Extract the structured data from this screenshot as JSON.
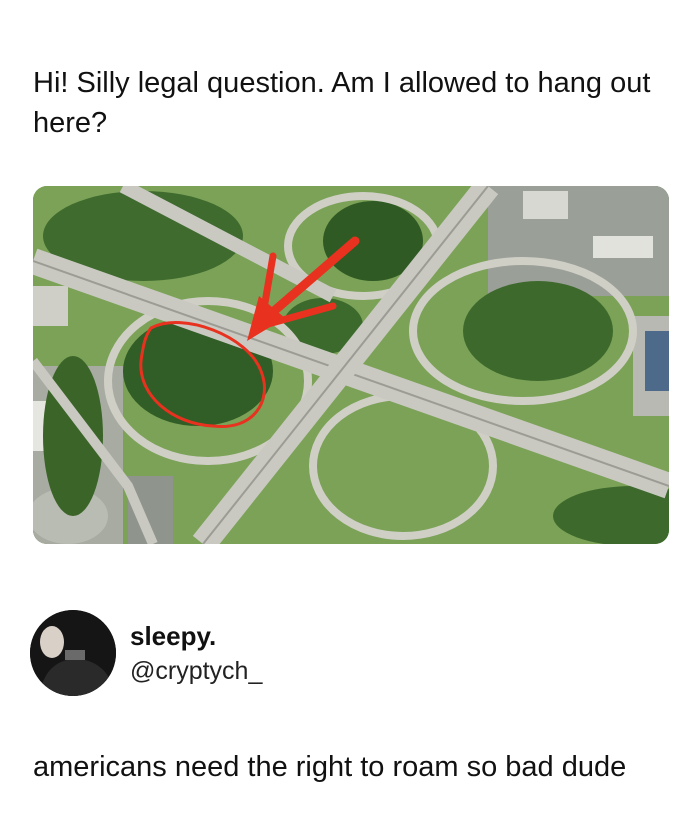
{
  "post": {
    "text": "Hi! Silly legal question. Am I allowed to hang out here?",
    "image": {
      "description_icon": "aerial-photo-icon",
      "annotation_color": "#e8321f",
      "grass_color": "#7ba257",
      "road_color": "#c9c9c2"
    }
  },
  "reply": {
    "display_name": "sleepy.",
    "handle": "@cryptych_",
    "text": "americans need the right to roam so bad dude"
  }
}
